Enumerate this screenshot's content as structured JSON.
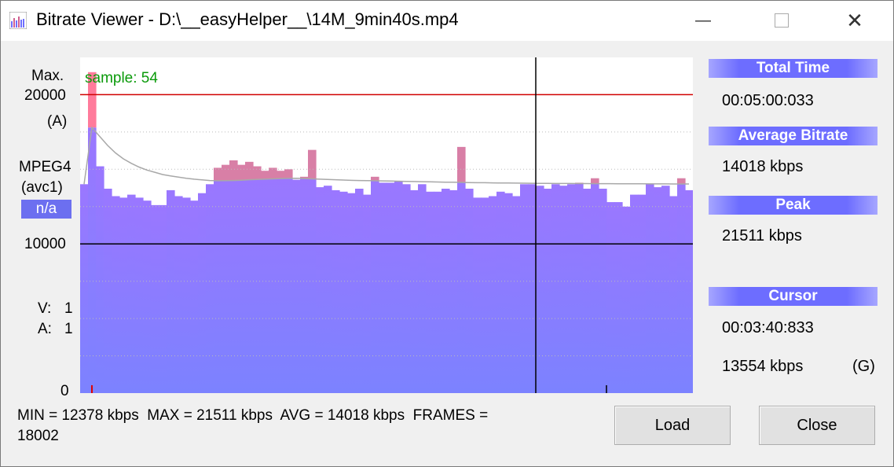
{
  "window": {
    "title": "Bitrate Viewer - D:\\__easyHelper__\\14M_9min40s.mp4",
    "controls": {
      "minimize": "—",
      "close": "✕"
    }
  },
  "y_axis": {
    "max_label": "Max.",
    "max_value": "20000",
    "max_mode": "(A)",
    "codec": "MPEG4",
    "codec_sub": "(avc1)",
    "codec_badge": "n/a",
    "mid_value": "10000",
    "zero_value": "0",
    "v_label": "V:",
    "v_value": "1",
    "a_label": "A:",
    "a_value": "1"
  },
  "chart_data": {
    "type": "bar",
    "annotation": "sample: 54",
    "ylim": [
      0,
      22500
    ],
    "max_line": 20000,
    "mid_line": 10000,
    "total_bars": 78,
    "cursor_index": 58,
    "marker_index": 67,
    "red_tick_index": 1,
    "values": [
      14000,
      21511,
      15200,
      13700,
      13200,
      13100,
      13300,
      13100,
      12900,
      12600,
      12600,
      13600,
      13200,
      13100,
      12900,
      13400,
      14000,
      15100,
      15300,
      15600,
      15300,
      15500,
      15200,
      14900,
      15100,
      14900,
      15000,
      14300,
      14500,
      16300,
      13800,
      13900,
      13600,
      13500,
      13400,
      13700,
      13300,
      14500,
      14100,
      14100,
      14200,
      14000,
      13600,
      14000,
      13500,
      13500,
      13700,
      13600,
      16500,
      13700,
      13100,
      13100,
      13200,
      13500,
      13400,
      13200,
      14000,
      14000,
      13900,
      13700,
      14000,
      13900,
      14000,
      14100,
      13700,
      14400,
      13700,
      12800,
      12800,
      12500,
      13300,
      13300,
      14000,
      13800,
      13900,
      13200,
      14400,
      13600
    ],
    "average_curve": [
      14000,
      17800,
      17200,
      16600,
      16100,
      15700,
      15400,
      15150,
      14950,
      14800,
      14650,
      14560,
      14480,
      14400,
      14340,
      14290,
      14250,
      14230,
      14240,
      14250,
      14270,
      14300,
      14320,
      14340,
      14360,
      14380,
      14390,
      14400,
      14380,
      14360,
      14340,
      14320,
      14300,
      14280,
      14260,
      14250,
      14240,
      14230,
      14220,
      14210,
      14200,
      14190,
      14180,
      14170,
      14160,
      14150,
      14140,
      14130,
      14120,
      14110,
      14100,
      14100,
      14090,
      14085,
      14080,
      14075,
      14070,
      14065,
      14060,
      14055,
      14050,
      14048,
      14046,
      14044,
      14042,
      14040,
      14038,
      14035,
      14032,
      14030,
      14028,
      14026,
      14024,
      14022,
      14020,
      14019,
      14018,
      14018
    ],
    "colors": {
      "bar": "#9b7cff",
      "bar_top": "#7b7bff",
      "over_avg": "#d87fa6",
      "peak": "#ff7b9b",
      "max_line": "#d00000",
      "grid": "#bbbbbb",
      "annotation": "#0a9a0a",
      "avg_curve": "#a8a8a8"
    },
    "grid": true
  },
  "stats_panel": {
    "total_time_label": "Total Time",
    "total_time_value": "00:05:00:033",
    "avg_label": "Average Bitrate",
    "avg_value": "14018 kbps",
    "peak_label": "Peak",
    "peak_value": "21511 kbps",
    "cursor_label": "Cursor",
    "cursor_time": "00:03:40:833",
    "cursor_bitrate": "13554 kbps",
    "cursor_frame_type": "(G)"
  },
  "status": {
    "line1": "MIN = 12378 kbps  MAX = 21511 kbps  AVG = 14018 kbps  FRAMES =",
    "line2": "18002"
  },
  "buttons": {
    "load": "Load",
    "close": "Close"
  }
}
